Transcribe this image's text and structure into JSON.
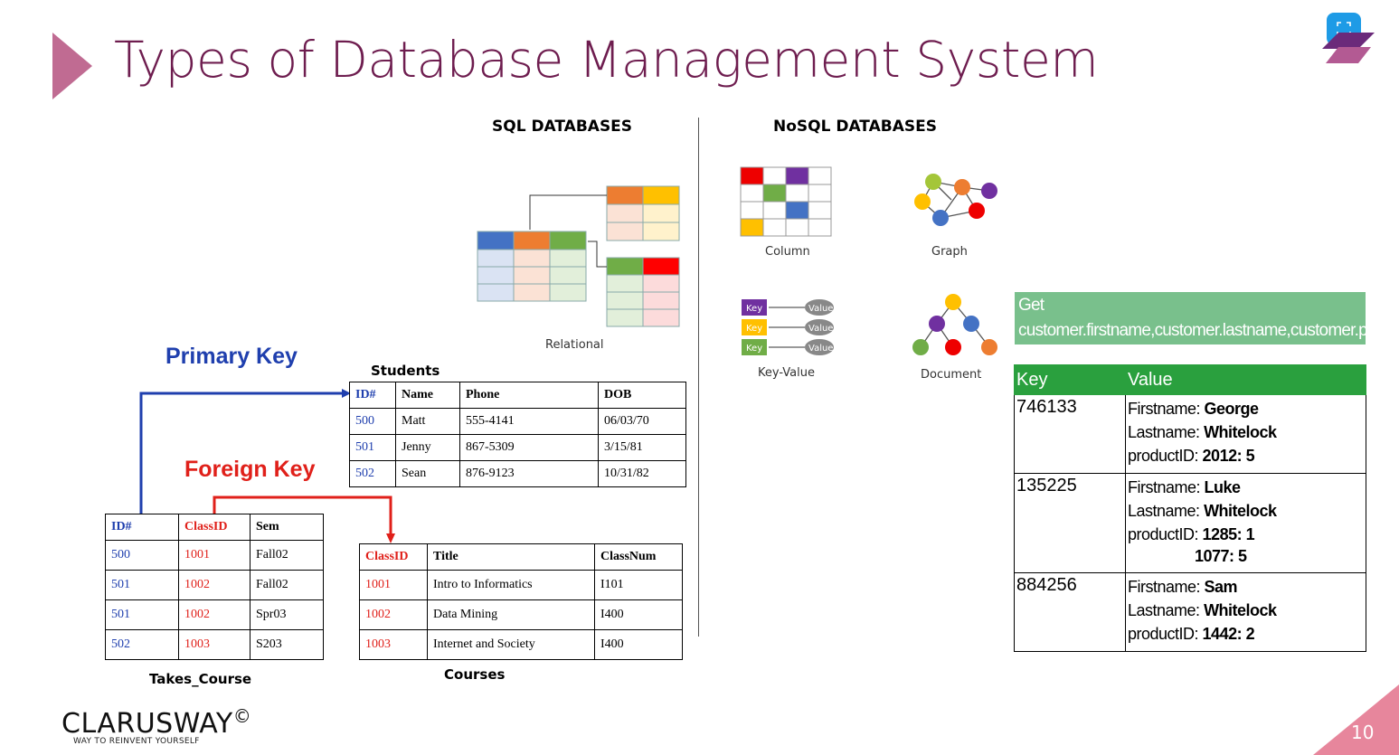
{
  "slide": {
    "title": "Types of Database Management System",
    "page_number": "10"
  },
  "brand": {
    "name": "CLARUSWAY",
    "copyright": "©",
    "tagline": "WAY TO REINVENT YOURSELF"
  },
  "sections": {
    "sql": "SQL DATABASES",
    "nosql": "NoSQL DATABASES"
  },
  "diagrams": {
    "relational": "Relational",
    "column": "Column",
    "graph": "Graph",
    "key_value": "Key-Value",
    "document": "Document",
    "kv_key": "Key",
    "kv_value": "Value"
  },
  "labels": {
    "primary_key": "Primary Key",
    "foreign_key": "Foreign Key"
  },
  "colors": {
    "title": "#6e1d4f",
    "accent": "#c06b92",
    "primary_key": "#1f3fae",
    "foreign_key": "#e0201a",
    "kv_header": "#2aa03e",
    "query_bg": "#79c08c"
  },
  "students": {
    "name": "Students",
    "headers": [
      "ID#",
      "Name",
      "Phone",
      "DOB"
    ],
    "rows": [
      [
        "500",
        "Matt",
        "555-4141",
        "06/03/70"
      ],
      [
        "501",
        "Jenny",
        "867-5309",
        "3/15/81"
      ],
      [
        "502",
        "Sean",
        "876-9123",
        "10/31/82"
      ]
    ]
  },
  "takes_course": {
    "name": "Takes_Course",
    "headers": [
      "ID#",
      "ClassID",
      "Sem"
    ],
    "rows": [
      [
        "500",
        "1001",
        "Fall02"
      ],
      [
        "501",
        "1002",
        "Fall02"
      ],
      [
        "501",
        "1002",
        "Spr03"
      ],
      [
        "502",
        "1003",
        "S203"
      ]
    ]
  },
  "courses": {
    "name": "Courses",
    "headers": [
      "ClassID",
      "Title",
      "ClassNum"
    ],
    "rows": [
      [
        "1001",
        "Intro to Informatics",
        "I101"
      ],
      [
        "1002",
        "Data Mining",
        "I400"
      ],
      [
        "1003",
        "Internet and Society",
        "I400"
      ]
    ]
  },
  "query": "Get customer.firstname,customer.lastname,customer.productID.* where Last_Name='Whitelock'",
  "kv_table": {
    "headers": [
      "Key",
      "Value"
    ],
    "rows": [
      {
        "key": "746133",
        "firstname_label": "Firstname: ",
        "firstname": "George",
        "lastname_label": "Lastname: ",
        "lastname": "Whitelock",
        "product_label": "productID: ",
        "products": [
          "2012: 5"
        ]
      },
      {
        "key": "135225",
        "firstname_label": "Firstname: ",
        "firstname": "Luke",
        "lastname_label": "Lastname: ",
        "lastname": "Whitelock",
        "product_label": "productID: ",
        "products": [
          "1285: 1",
          "1077: 5"
        ]
      },
      {
        "key": "884256",
        "firstname_label": "Firstname: ",
        "firstname": "Sam",
        "lastname_label": "Lastname: ",
        "lastname": "Whitelock",
        "product_label": "productID: ",
        "products": [
          "1442: 2"
        ]
      }
    ]
  }
}
